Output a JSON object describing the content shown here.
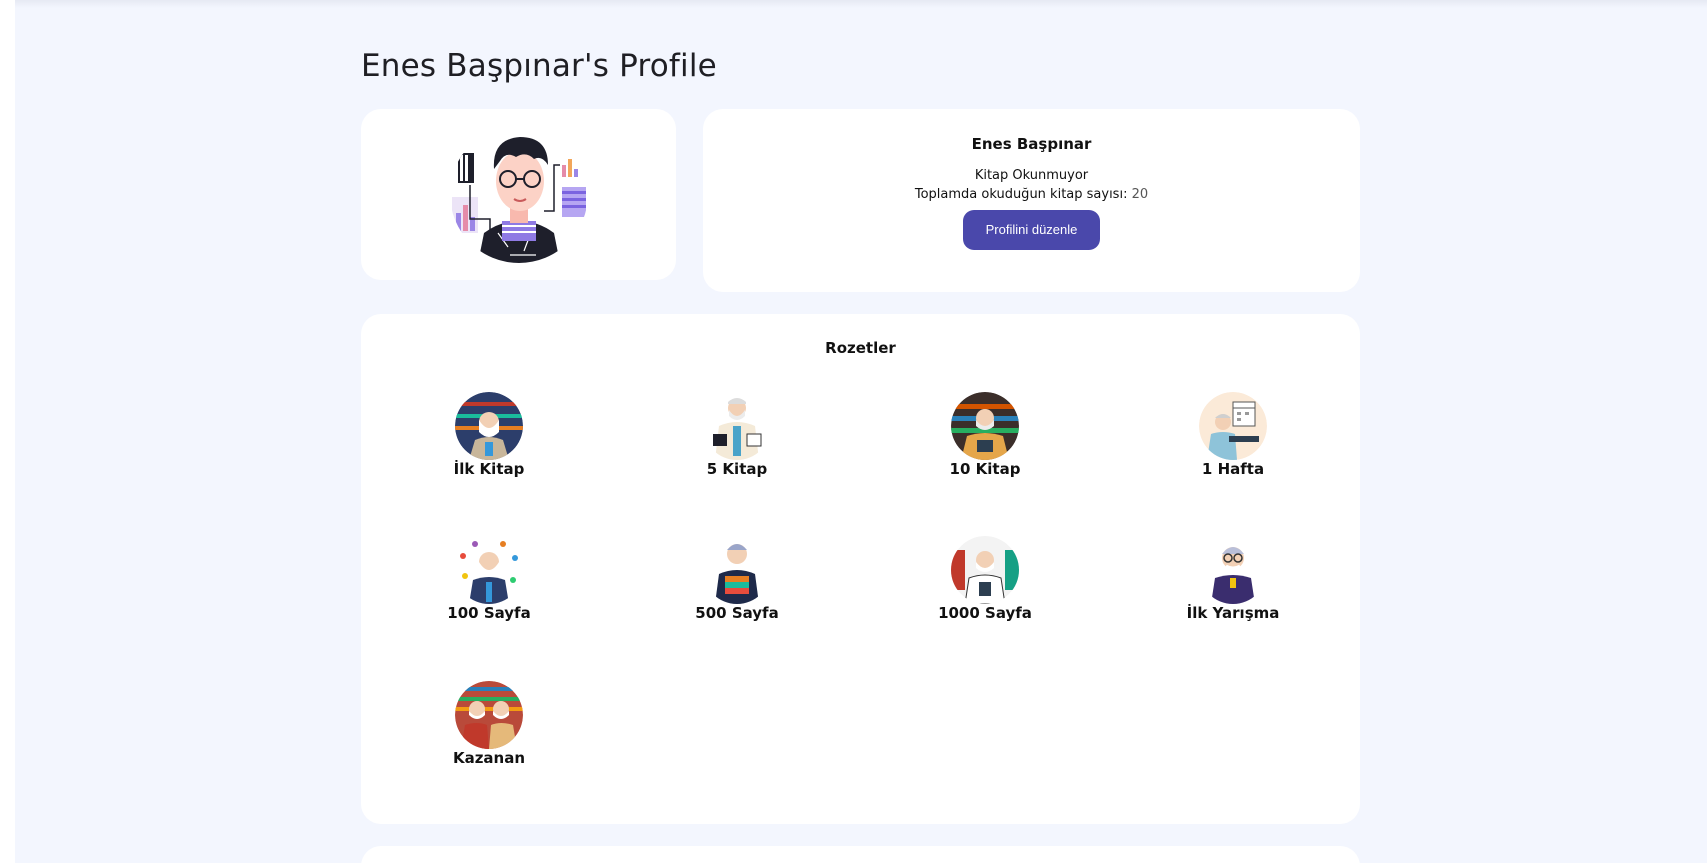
{
  "page": {
    "title": "Enes Başpınar's Profile"
  },
  "profile": {
    "avatar_icon": "developer-avatar-icon",
    "name": "Enes Başpınar",
    "status": "Kitap Okunmuyor",
    "books_label": "Toplamda okuduğun kitap sayısı:",
    "books_count": "20",
    "edit_button": "Profilini düzenle"
  },
  "badges": {
    "title": "Rozetler",
    "items": [
      {
        "label": "İlk Kitap",
        "icon": "librarian-badge-icon"
      },
      {
        "label": "5 Kitap",
        "icon": "reader-badge-icon"
      },
      {
        "label": "10 Kitap",
        "icon": "bookshelf-badge-icon"
      },
      {
        "label": "1 Hafta",
        "icon": "calendar-badge-icon"
      },
      {
        "label": "100 Sayfa",
        "icon": "page-badge-icon"
      },
      {
        "label": "500 Sayfa",
        "icon": "book-stack-badge-icon"
      },
      {
        "label": "1000 Sayfa",
        "icon": "scholar-badge-icon"
      },
      {
        "label": "İlk Yarışma",
        "icon": "competition-badge-icon"
      },
      {
        "label": "Kazanan",
        "icon": "winner-badge-icon"
      }
    ]
  },
  "colors": {
    "accent": "#4a48ab",
    "background": "#f3f6fe",
    "card": "#ffffff"
  }
}
